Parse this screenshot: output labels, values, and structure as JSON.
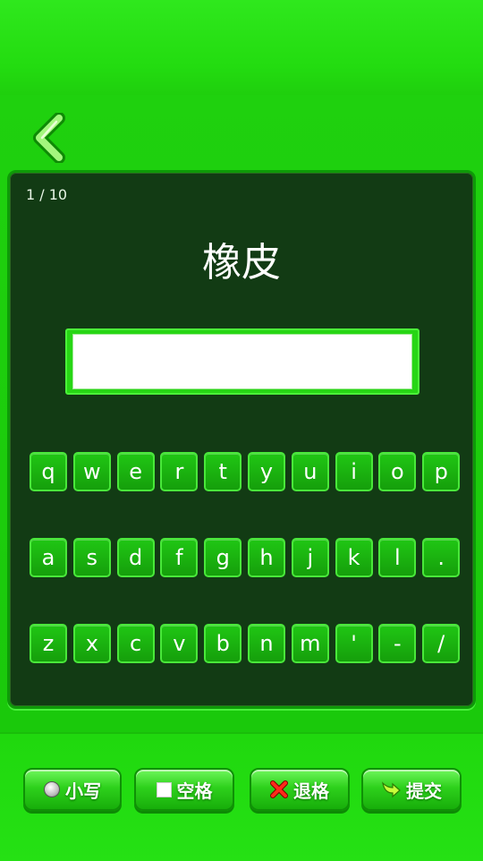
{
  "header": {
    "back_icon": "back-chevron-icon"
  },
  "progress": {
    "text": "1 / 10",
    "current": 1,
    "total": 10
  },
  "question": {
    "word": "橡皮"
  },
  "answer": {
    "value": "",
    "placeholder": ""
  },
  "keyboard": {
    "rows": [
      [
        "q",
        "w",
        "e",
        "r",
        "t",
        "y",
        "u",
        "i",
        "o",
        "p"
      ],
      [
        "a",
        "s",
        "d",
        "f",
        "g",
        "h",
        "j",
        "k",
        "l",
        "."
      ],
      [
        "z",
        "x",
        "c",
        "v",
        "b",
        "n",
        "m",
        "'",
        "-",
        "/"
      ]
    ]
  },
  "actions": {
    "lowercase": {
      "label": "小写",
      "icon": "radio-icon"
    },
    "space": {
      "label": "空格",
      "icon": "square-icon"
    },
    "backspace": {
      "label": "退格",
      "icon": "red-x-icon"
    },
    "submit": {
      "label": "提交",
      "icon": "green-arrow-icon"
    }
  },
  "colors": {
    "background": "#22dd11",
    "board": "#123b14",
    "key": "#1aba10",
    "key_border": "#49e83a"
  }
}
